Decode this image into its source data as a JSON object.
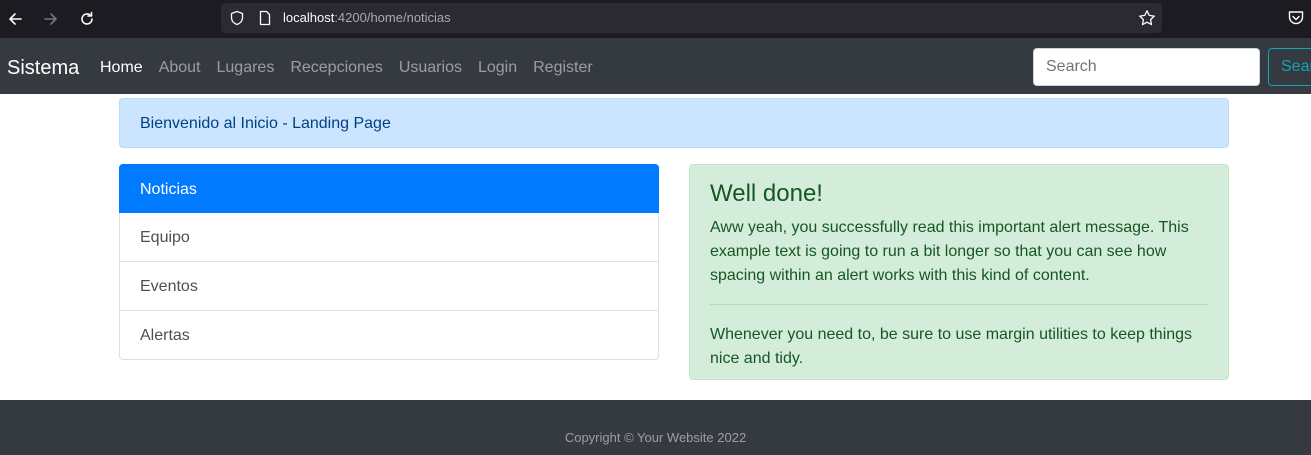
{
  "browser": {
    "url_host": "localhost",
    "url_rest": ":4200/home/noticias",
    "icons": [
      "back-arrow-icon",
      "forward-arrow-icon",
      "reload-icon",
      "shield-icon",
      "page-icon",
      "star-icon",
      "pocket-icon"
    ]
  },
  "navbar": {
    "brand": "Sistema",
    "links": [
      {
        "label": "Home",
        "active": true
      },
      {
        "label": "About"
      },
      {
        "label": "Lugares"
      },
      {
        "label": "Recepciones"
      },
      {
        "label": "Usuarios"
      },
      {
        "label": "Login"
      },
      {
        "label": "Register"
      }
    ],
    "search_placeholder": "Search",
    "search_button": "Search"
  },
  "welcome": {
    "text": "Bienvenido al Inicio - Landing Page"
  },
  "list": {
    "items": [
      {
        "label": "Noticias",
        "active": true
      },
      {
        "label": "Equipo"
      },
      {
        "label": "Eventos"
      },
      {
        "label": "Alertas"
      }
    ]
  },
  "alert": {
    "heading": "Well done!",
    "body": "Aww yeah, you successfully read this important alert message. This example text is going to run a bit longer so that you can see how spacing within an alert works with this kind of content.",
    "footer": "Whenever you need to, be sure to use margin utilities to keep things nice and tidy."
  },
  "footer": {
    "copyright": "Copyright © Your Website 2022"
  },
  "colors": {
    "navbar_bg": "#343a40",
    "primary": "#007bff",
    "info": "#17a2b8",
    "alert_primary_bg": "#cce5ff",
    "alert_success_bg": "#d4edda"
  }
}
